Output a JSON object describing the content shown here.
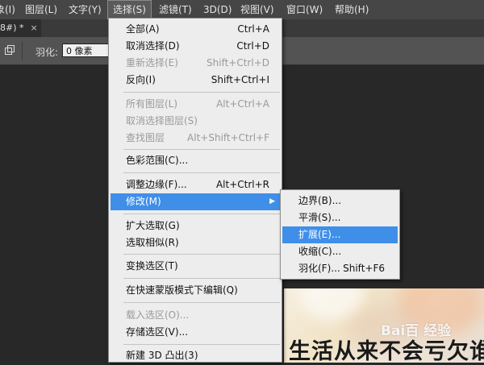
{
  "menubar": {
    "items": [
      "象(I)",
      "图层(L)",
      "文字(Y)",
      "选择(S)",
      "滤镜(T)",
      "3D(D)",
      "视图(V)",
      "窗口(W)",
      "帮助(H)"
    ]
  },
  "tab": {
    "title": "8#) *",
    "close": "×"
  },
  "options": {
    "feather_label": "羽化:",
    "feather_value": "0 像素"
  },
  "select_menu": {
    "items": [
      {
        "label": "全部(A)",
        "shortcut": "Ctrl+A"
      },
      {
        "label": "取消选择(D)",
        "shortcut": "Ctrl+D"
      },
      {
        "label": "重新选择(E)",
        "shortcut": "Shift+Ctrl+D"
      },
      {
        "label": "反向(I)",
        "shortcut": "Shift+Ctrl+I"
      },
      {
        "label": "所有图层(L)",
        "shortcut": "Alt+Ctrl+A"
      },
      {
        "label": "取消选择图层(S)",
        "shortcut": ""
      },
      {
        "label": "查找图层",
        "shortcut": "Alt+Shift+Ctrl+F"
      },
      {
        "label": "色彩范围(C)...",
        "shortcut": ""
      },
      {
        "label": "调整边缘(F)...",
        "shortcut": "Alt+Ctrl+R"
      },
      {
        "label": "修改(M)",
        "shortcut": ""
      },
      {
        "label": "扩大选取(G)",
        "shortcut": ""
      },
      {
        "label": "选取相似(R)",
        "shortcut": ""
      },
      {
        "label": "变换选区(T)",
        "shortcut": ""
      },
      {
        "label": "在快速蒙版模式下编辑(Q)",
        "shortcut": ""
      },
      {
        "label": "载入选区(O)...",
        "shortcut": ""
      },
      {
        "label": "存储选区(V)...",
        "shortcut": ""
      },
      {
        "label": "新建 3D 凸出(3)",
        "shortcut": ""
      }
    ]
  },
  "modify_submenu": {
    "items": [
      {
        "label": "边界(B)...",
        "shortcut": ""
      },
      {
        "label": "平滑(S)...",
        "shortcut": ""
      },
      {
        "label": "扩展(E)...",
        "shortcut": ""
      },
      {
        "label": "收缩(C)...",
        "shortcut": ""
      },
      {
        "label": "羽化(F)...",
        "shortcut": "Shift+F6"
      }
    ]
  },
  "canvas": {
    "image_text": "生活从来不会亏欠谁",
    "watermark": "Bai百 经验"
  },
  "colors": {
    "highlight": "#3f8fe8",
    "menu_bg": "#ededed",
    "menubar_bg": "#464646"
  }
}
